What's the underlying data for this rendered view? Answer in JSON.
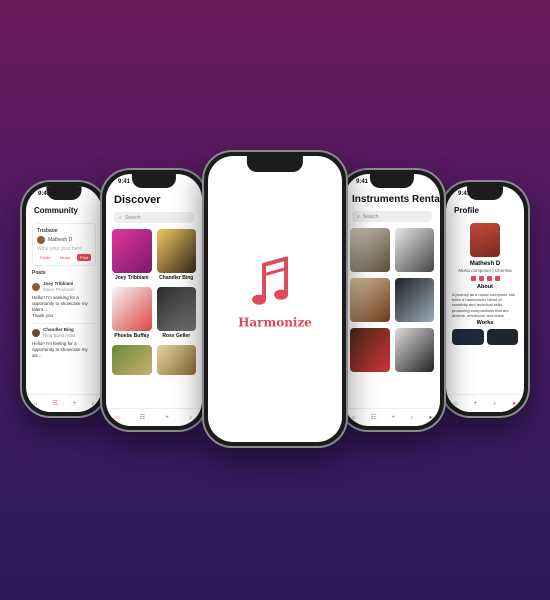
{
  "status_time": "9:41",
  "community": {
    "title": "Community",
    "input_label": "Trisbaoe",
    "user": "Mathesh D",
    "input_placeholder": "Write your post here...",
    "actions": [
      "Photo",
      "Music",
      "Post"
    ],
    "posts_label": "Posts",
    "posts": [
      {
        "author": "Joey Tribbiani",
        "sub": "Music Producer",
        "text": "Hello!! I'm seeking for a opportunity to showcase my talent...",
        "reply": "Thank you"
      },
      {
        "author": "Chandler Bing",
        "sub": "Ring Band Artist",
        "text": "Hello!! I'm feeling for a opportunity to showcase my art..."
      }
    ]
  },
  "discover": {
    "title": "Discover",
    "search_placeholder": "Search",
    "artists": [
      "Joey Tribbiani",
      "Chandler Bing",
      "Phoebe Buffay",
      "Ross Geller",
      "",
      ""
    ]
  },
  "brand": {
    "name": "Harmonize",
    "accent": "#e0485b"
  },
  "rental": {
    "title": "Instruments Rental",
    "search_placeholder": "Search"
  },
  "profile": {
    "title": "Profile",
    "name": "Mathesh D",
    "role": "Music composer | Chennai",
    "about_label": "About",
    "about_text": "A journey as a music composer has been a harmonious blend of creativity and technical skills, producing compositions that are diverse, emotional, and leave memorable marks in the world of sound.",
    "works_label": "Works"
  },
  "tabs": [
    "home-icon",
    "people-icon",
    "add-icon",
    "instrument-icon",
    "profile-icon"
  ]
}
